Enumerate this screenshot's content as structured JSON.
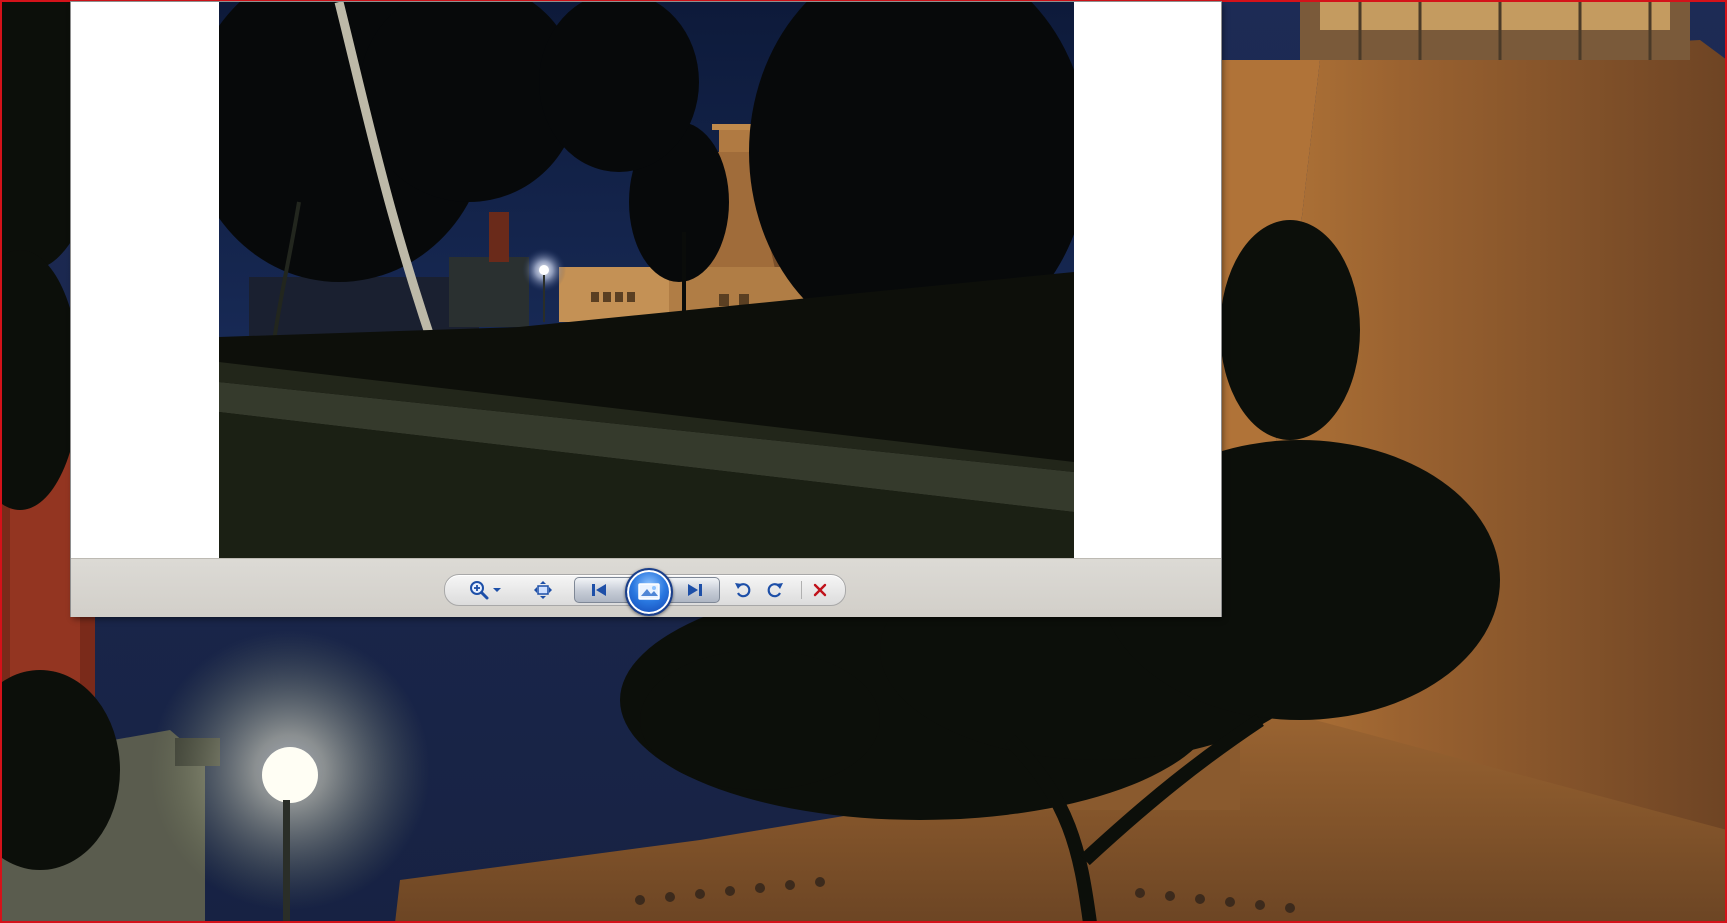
{
  "colors": {
    "frame_border": "#d4121a",
    "toolbar_bg": "#d6d3cd",
    "accent_blue": "#2a78e0",
    "icon_blue": "#1d4fa8",
    "close_red": "#c0121b"
  },
  "viewer": {
    "toolbar": {
      "buttons": [
        {
          "id": "zoom",
          "icon": "magnifier-plus-icon"
        },
        {
          "id": "zoom-menu",
          "icon": "dropdown-arrow-icon"
        },
        {
          "id": "actual-size",
          "icon": "fit-window-icon"
        },
        {
          "id": "previous",
          "icon": "skip-previous-icon"
        },
        {
          "id": "slideshow",
          "icon": "slideshow-icon"
        },
        {
          "id": "next",
          "icon": "skip-next-icon"
        },
        {
          "id": "rotate-counterclockwise",
          "icon": "rotate-left-icon"
        },
        {
          "id": "rotate-clockwise",
          "icon": "rotate-right-icon"
        },
        {
          "id": "delete",
          "icon": "close-x-icon"
        }
      ]
    }
  }
}
